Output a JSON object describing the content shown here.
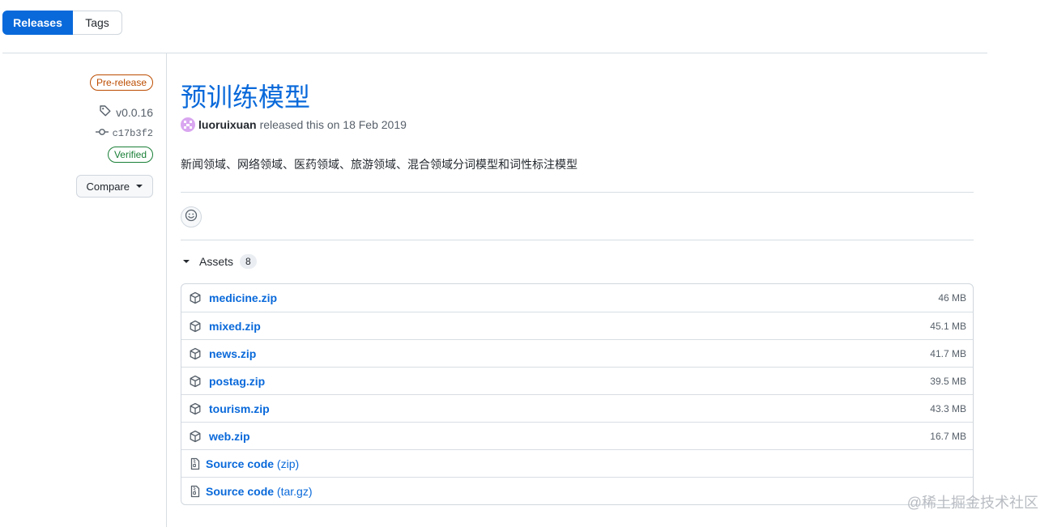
{
  "tabs": {
    "releases": "Releases",
    "tags": "Tags"
  },
  "meta": {
    "prerelease": "Pre-release",
    "tag": "v0.0.16",
    "commit": "c17b3f2",
    "verified": "Verified",
    "compare": "Compare"
  },
  "release": {
    "title": "预训练模型",
    "author": "luoruixuan",
    "released_text": "released this on 18 Feb 2019",
    "description": "新闻领域、网络领域、医药领域、旅游领域、混合领域分词模型和词性标注模型"
  },
  "assets": {
    "label": "Assets",
    "count": "8",
    "files": [
      {
        "name": "medicine.zip",
        "size": "46 MB"
      },
      {
        "name": "mixed.zip",
        "size": "45.1 MB"
      },
      {
        "name": "news.zip",
        "size": "41.7 MB"
      },
      {
        "name": "postag.zip",
        "size": "39.5 MB"
      },
      {
        "name": "tourism.zip",
        "size": "43.3 MB"
      },
      {
        "name": "web.zip",
        "size": "16.7 MB"
      }
    ],
    "sources": [
      {
        "label": "Source code",
        "format": "(zip)"
      },
      {
        "label": "Source code",
        "format": "(tar.gz)"
      }
    ]
  },
  "watermark": "@稀土掘金技术社区",
  "icons": [
    "tag-icon",
    "commit-icon",
    "smiley-icon",
    "package-icon",
    "file-zip-icon",
    "caret-down-icon"
  ],
  "colors": {
    "accent": "#0969da",
    "prerelease": "#bc4c00",
    "verified": "#1a7f37"
  }
}
